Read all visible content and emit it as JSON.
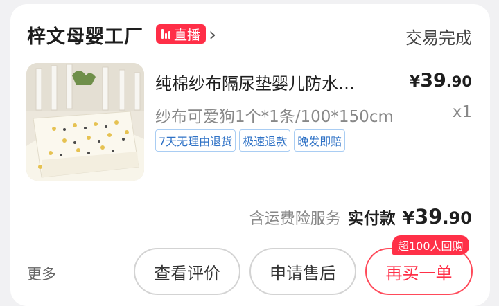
{
  "shop": {
    "name": "梓文母婴工厂",
    "live_label": "直播",
    "order_status": "交易完成"
  },
  "product": {
    "title": "纯棉纱布隔尿垫婴儿防水…",
    "price_currency": "¥",
    "price_integer": "39",
    "price_decimal": ".90",
    "spec": "纱布可爱狗1个*1条/100*150cm",
    "quantity": "x1",
    "tags": [
      "7天无理由退货",
      "极速退款",
      "晚发即赔"
    ]
  },
  "summary": {
    "insurance_note": "含运费险服务",
    "paid_label": "实付款",
    "total_currency": "¥",
    "total_integer": "39",
    "total_decimal": ".90"
  },
  "actions": {
    "more_label": "更多",
    "review_label": "查看评价",
    "after_sales_label": "申请售后",
    "rebuy_label": "再买一单",
    "rebuy_badge": "超100人回购"
  },
  "colors": {
    "accent_red": "#ff3048",
    "tag_blue": "#2f72c6",
    "tag_border": "#a9cdf3"
  },
  "icons": {
    "live": "live-bars-icon",
    "shop_link": "chevron-right-icon"
  }
}
